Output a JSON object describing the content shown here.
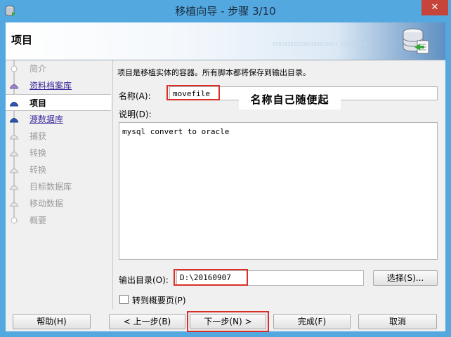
{
  "window": {
    "title": "移植向导 - 步骤 3/10",
    "close_glyph": "✕",
    "icon": "database-wizard-icon"
  },
  "banner": {
    "title": "项目",
    "binary_text": "0101010101010101010101 010101010",
    "icon": "database-migrate-icon"
  },
  "sidebar": {
    "steps": [
      {
        "label": "简介",
        "state": "disabled"
      },
      {
        "label": "资料档案库",
        "state": "link"
      },
      {
        "label": "项目",
        "state": "current"
      },
      {
        "label": "源数据库",
        "state": "link"
      },
      {
        "label": "捕获",
        "state": "disabled"
      },
      {
        "label": "转换",
        "state": "disabled"
      },
      {
        "label": "转换",
        "state": "disabled"
      },
      {
        "label": "目标数据库",
        "state": "disabled"
      },
      {
        "label": "移动数据",
        "state": "disabled"
      },
      {
        "label": "概要",
        "state": "disabled"
      }
    ]
  },
  "form": {
    "instruction": "项目是移植实体的容器。所有脚本都将保存到输出目录。",
    "name_label": "名称(A):",
    "name_value": "movefile",
    "description_label": "说明(D):",
    "description_value": "mysql convert to oracle",
    "output_label": "输出目录(O):",
    "output_value": "D:\\20160907",
    "browse_button": "选择(S)...",
    "goto_summary_label": "转到概要页(P)",
    "goto_summary_checked": false
  },
  "annotation": {
    "text": "名称自己随便起"
  },
  "buttons": {
    "help": "帮助(H)",
    "back": "< 上一步(B)",
    "next": "下一步(N) >",
    "finish": "完成(F)",
    "cancel": "取消"
  },
  "colors": {
    "titlebar": "#54a8e0",
    "close": "#c7443a",
    "highlight_box": "#d9302a",
    "link": "#3a2a9a"
  }
}
